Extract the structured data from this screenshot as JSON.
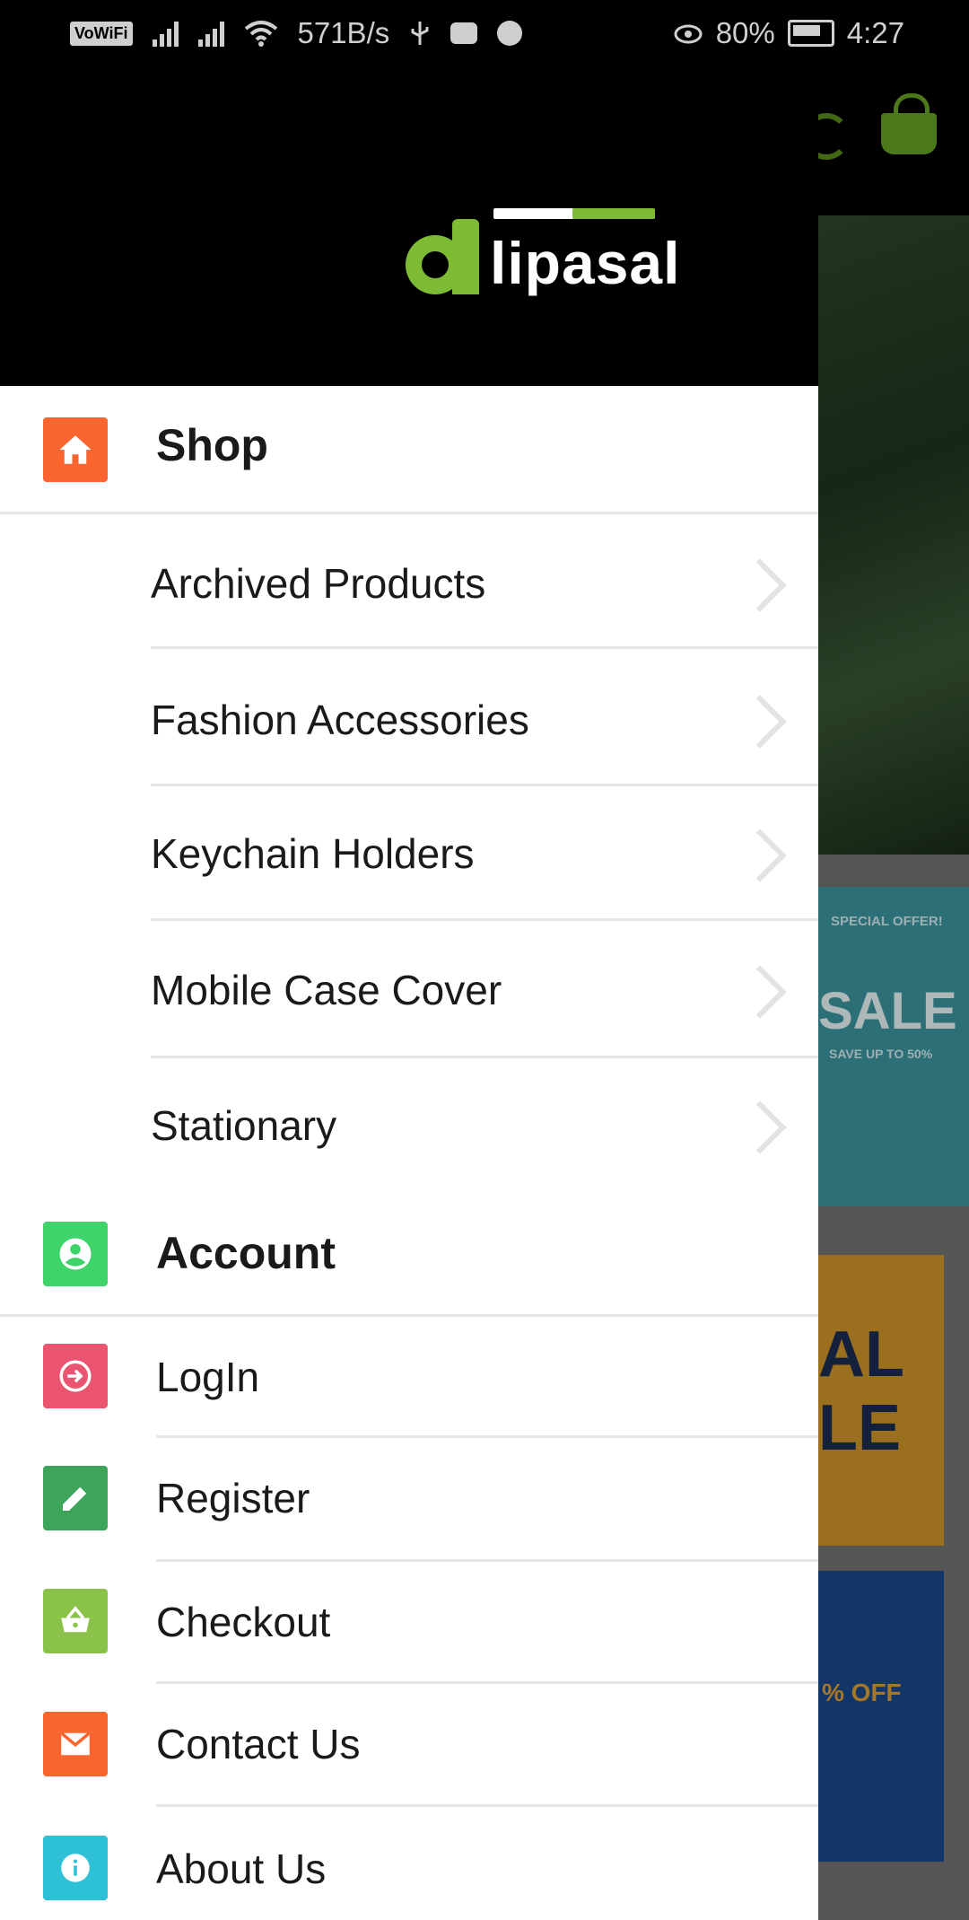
{
  "status_bar": {
    "vowifi": "VoWiFi",
    "network_speed": "571B/s",
    "battery": "80%",
    "time": "4:27"
  },
  "app": {
    "logo_text": "lipasal",
    "logo_letter": "a",
    "brand_color": "#7dbb35"
  },
  "drawer": {
    "shop_section": {
      "label": "Shop",
      "icon": "home-icon",
      "color": "#fb6530"
    },
    "categories": [
      {
        "label": "Archived Products"
      },
      {
        "label": "Fashion Accessories"
      },
      {
        "label": "Keychain Holders"
      },
      {
        "label": "Mobile Case Cover"
      },
      {
        "label": "Stationary"
      }
    ],
    "account_section": {
      "label": "Account",
      "icon": "account-circle-icon",
      "color": "#3ed46a"
    },
    "account_items": [
      {
        "label": "LogIn",
        "icon": "login-icon",
        "color": "#ea5470"
      },
      {
        "label": "Register",
        "icon": "pencil-icon",
        "color": "#3da55a"
      },
      {
        "label": "Checkout",
        "icon": "basket-icon",
        "color": "#8bc34a"
      },
      {
        "label": "Contact Us",
        "icon": "mail-icon",
        "color": "#fb6530"
      },
      {
        "label": "About Us",
        "icon": "info-icon",
        "color": "#2ec0d6"
      }
    ]
  },
  "background_banners": {
    "banner1_line1": "SPECIAL OFFER!",
    "banner1_line2": "SALE",
    "banner1_line3": "SAVE UP TO 50%",
    "banner2_text": "AL LE",
    "banner3_text": "% OFF"
  }
}
